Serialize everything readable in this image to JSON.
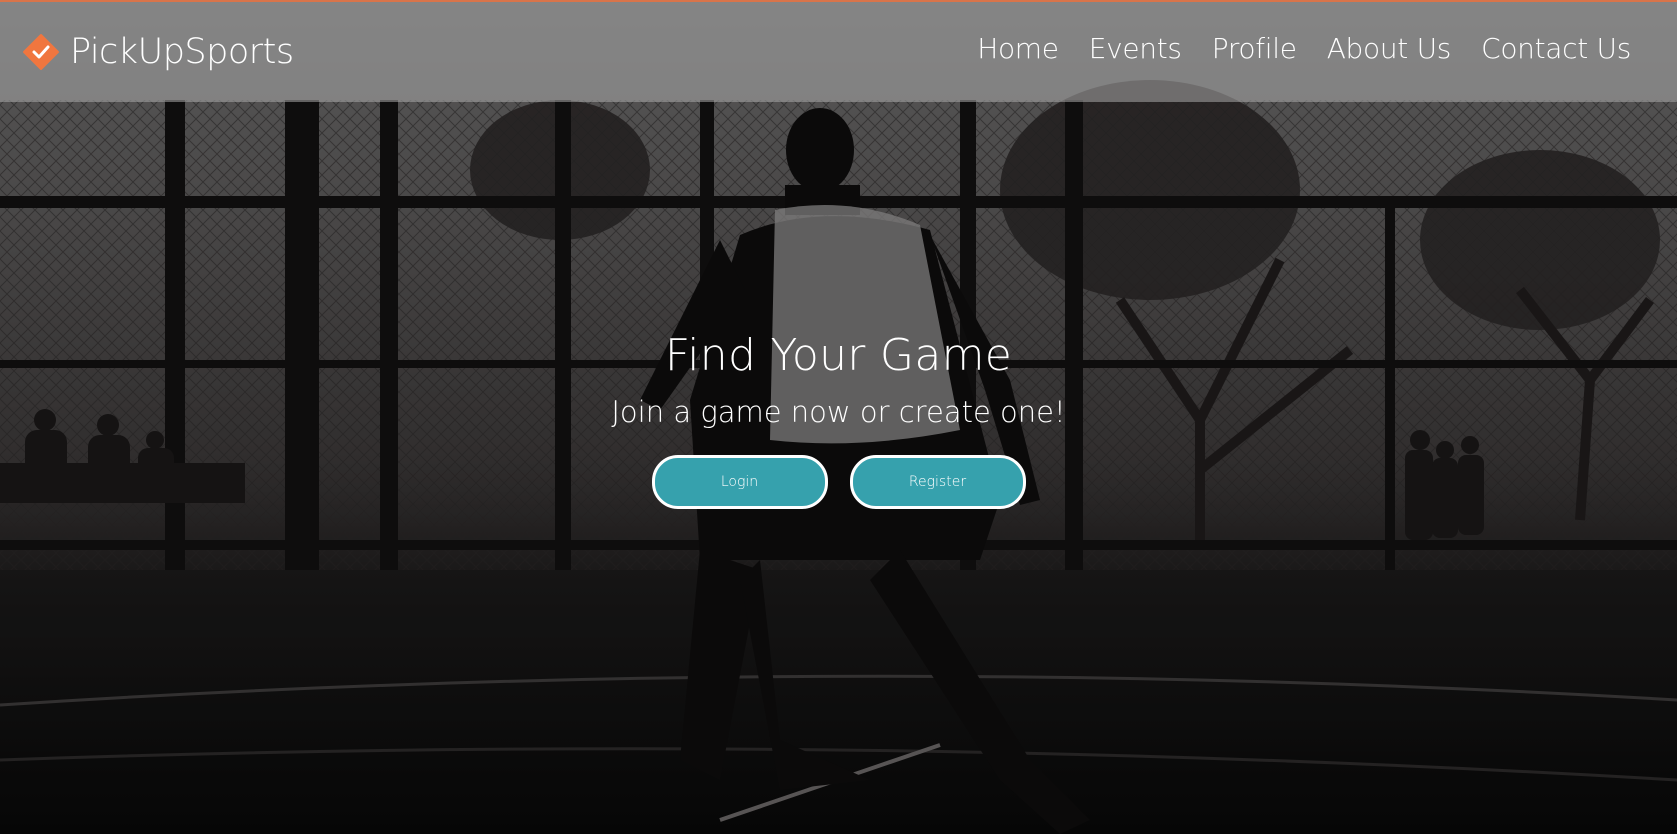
{
  "brand": {
    "name": "PickUpSports",
    "icon": "check-diamond-icon",
    "accent_color": "#f0763f"
  },
  "nav": {
    "items": [
      {
        "label": "Home"
      },
      {
        "label": "Events"
      },
      {
        "label": "Profile"
      },
      {
        "label": "About Us"
      },
      {
        "label": "Contact Us"
      }
    ]
  },
  "hero": {
    "title": "Find Your Game",
    "subtitle": "Join a game now or create one!",
    "background": "basketball-player-outdoor-court-photo",
    "buttons": {
      "login_label": "Login",
      "register_label": "Register",
      "button_color": "#36a1ad"
    }
  }
}
